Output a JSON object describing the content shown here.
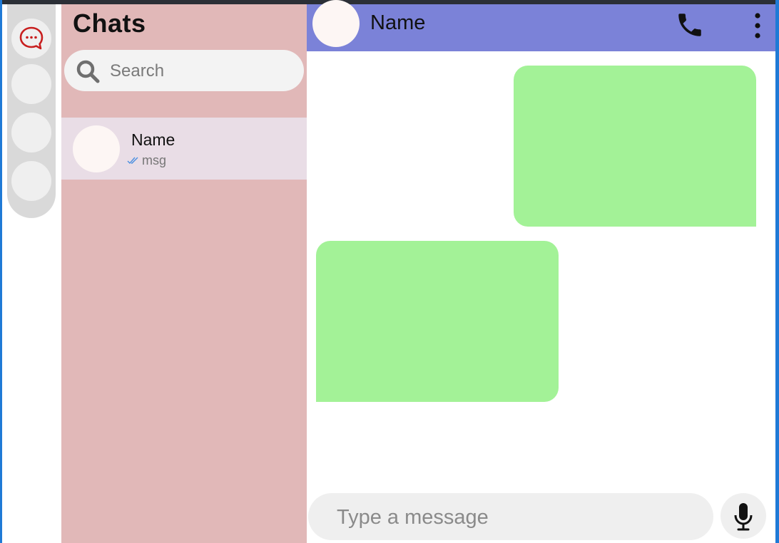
{
  "nav_rail": {
    "items": [
      {
        "icon": "chat-bubble-icon",
        "accent": "#c81e1e",
        "active": true
      },
      {
        "icon": "blank"
      },
      {
        "icon": "blank"
      },
      {
        "icon": "blank"
      }
    ]
  },
  "sidebar": {
    "title": "Chats",
    "search": {
      "placeholder": "Search",
      "value": ""
    },
    "chats": [
      {
        "name": "Name",
        "last_message": "msg",
        "status_icon": "double-check-icon"
      }
    ]
  },
  "conversation": {
    "header": {
      "name": "Name",
      "actions": [
        "call-icon",
        "more-vertical-icon"
      ]
    },
    "messages": [
      {
        "direction": "outgoing",
        "text": ""
      },
      {
        "direction": "incoming",
        "text": ""
      }
    ],
    "composer": {
      "placeholder": "Type a message",
      "value": "",
      "send_icon": "microphone-icon"
    }
  },
  "colors": {
    "sidebar_bg": "#e1b8b8",
    "header_bg": "#7b82d8",
    "bubble_bg": "#a3f297",
    "selected_chat_bg": "#e9dde6",
    "accent": "#1f7ad6"
  }
}
